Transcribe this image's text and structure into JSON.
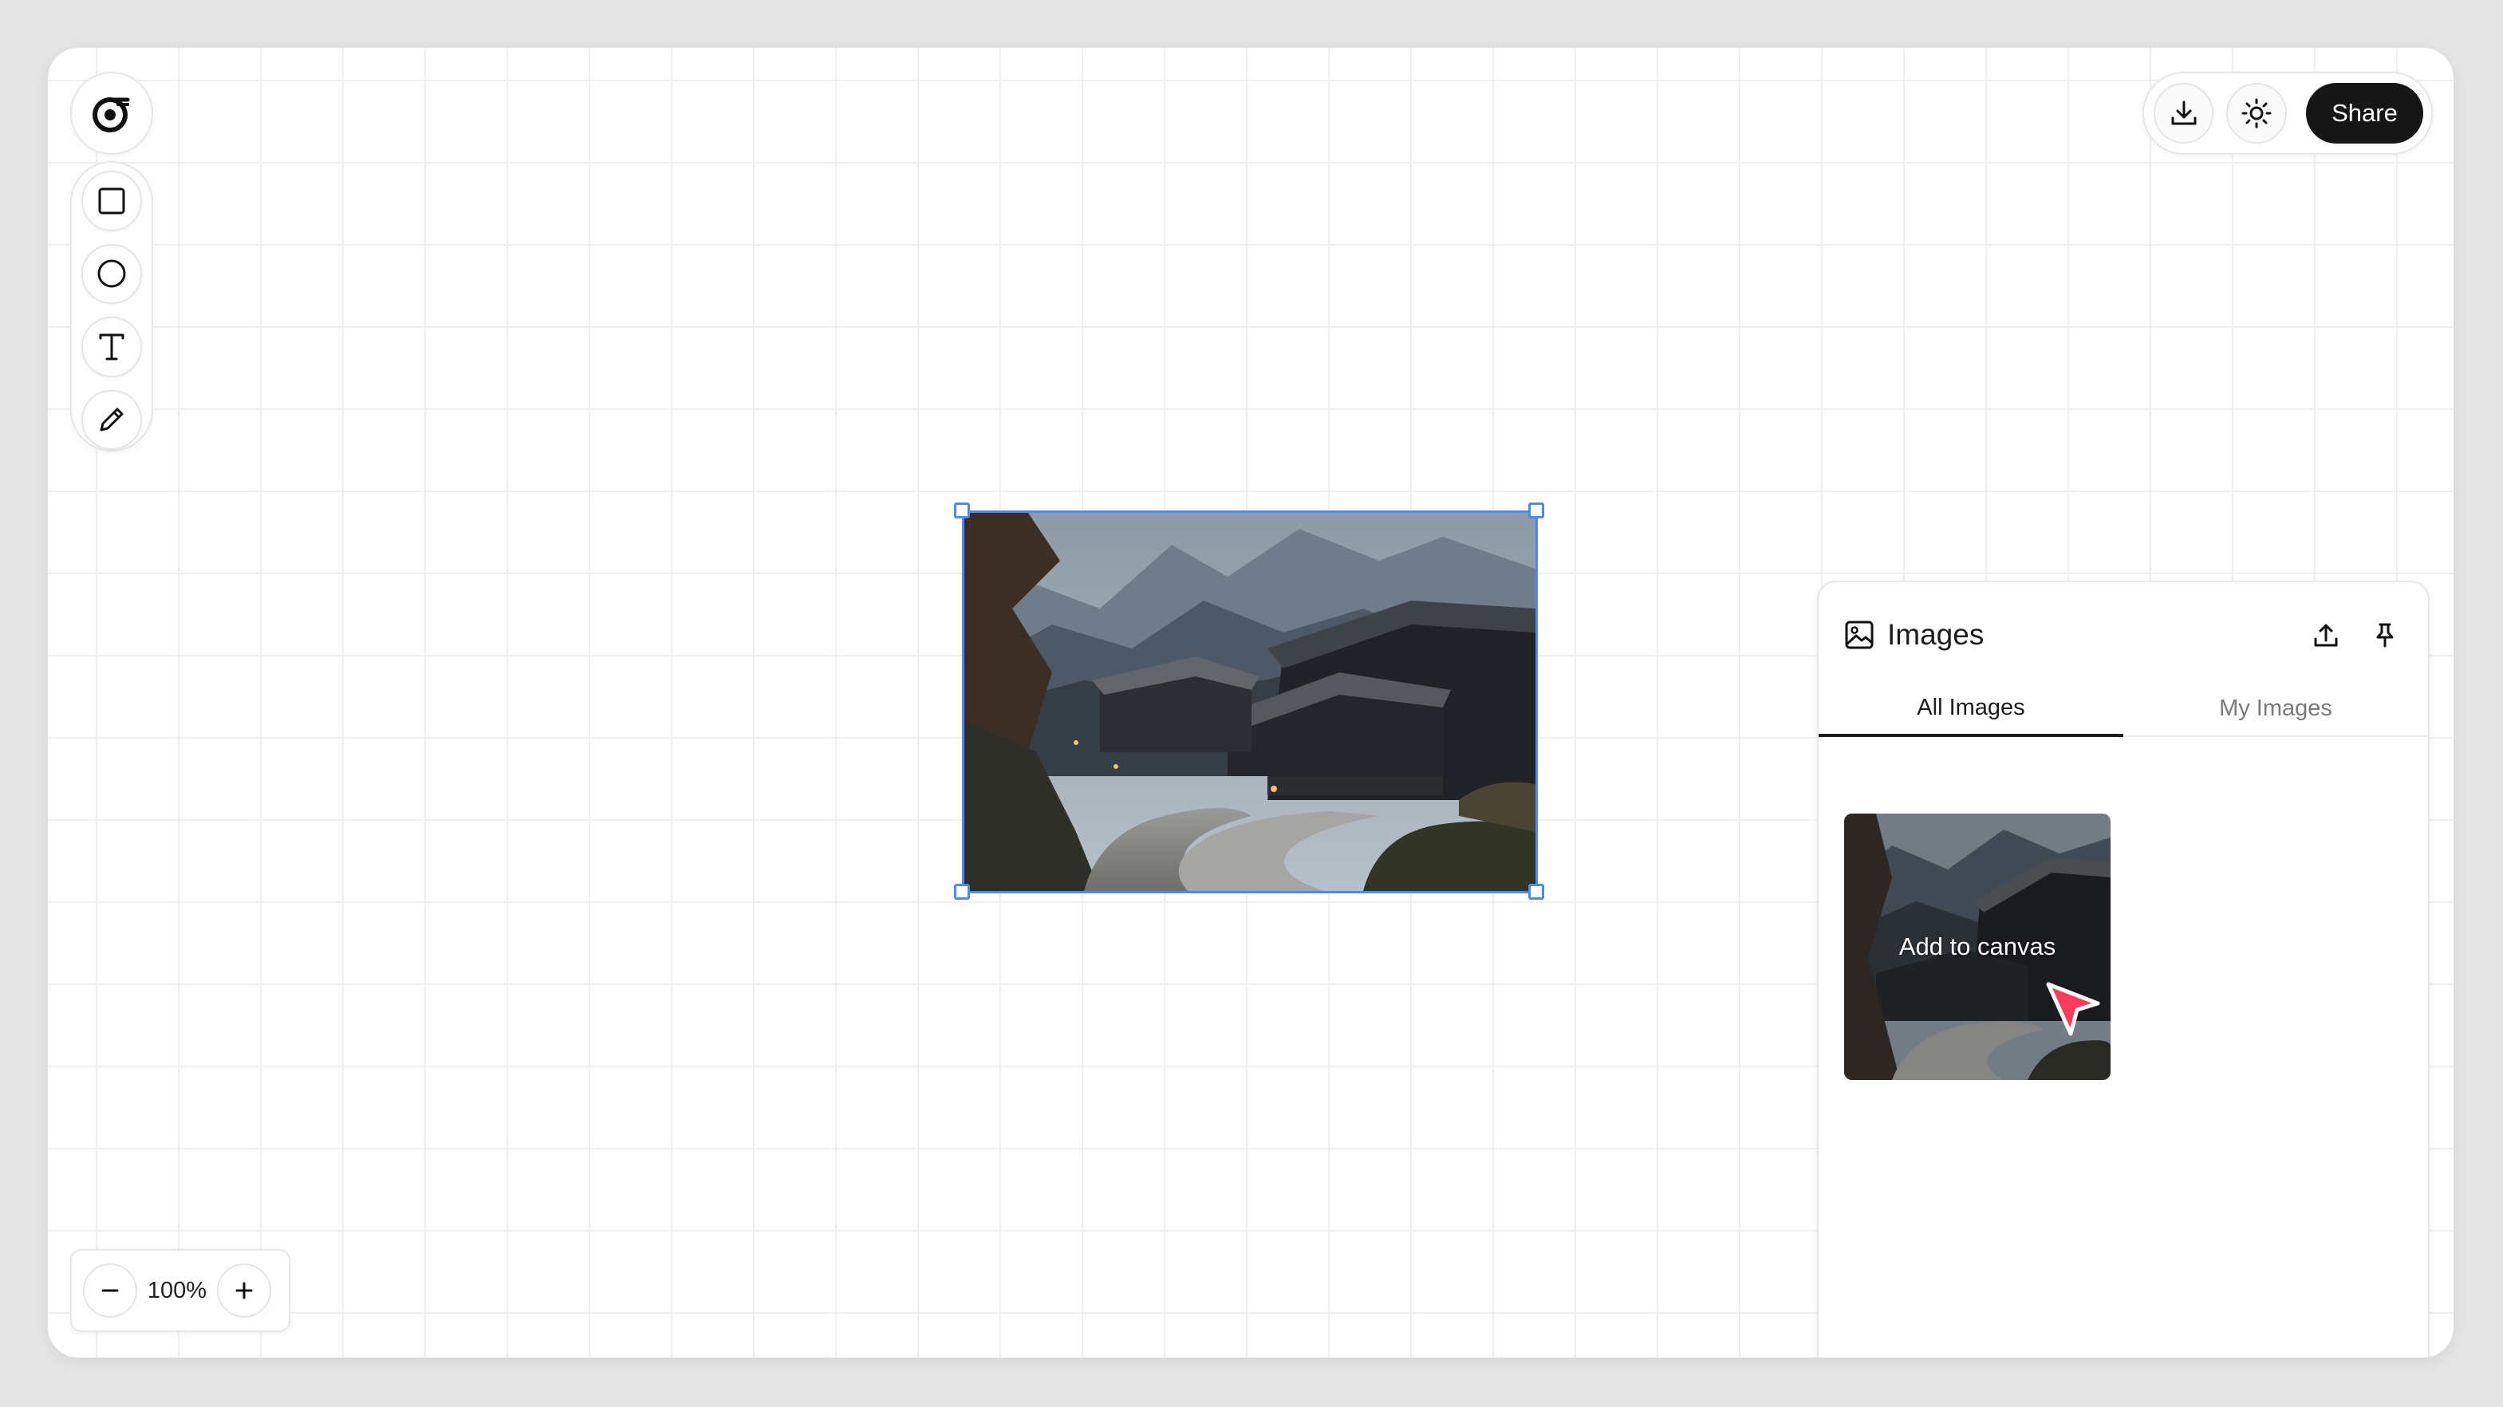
{
  "logo": {
    "name": "logo-icon"
  },
  "toolbar": {
    "tools": [
      {
        "id": "rectangle",
        "icon": "square-icon"
      },
      {
        "id": "ellipse",
        "icon": "circle-icon"
      },
      {
        "id": "text",
        "icon": "text-icon"
      },
      {
        "id": "pen",
        "icon": "pencil-icon"
      }
    ]
  },
  "actions": {
    "download_icon": "download-icon",
    "theme_icon": "sun-icon",
    "share_label": "Share"
  },
  "zoom": {
    "value": "100%",
    "decrease_icon": "minus-icon",
    "increase_icon": "plus-icon"
  },
  "images_panel": {
    "title": "Images",
    "tabs": [
      {
        "label": "All Images",
        "active": true
      },
      {
        "label": "My Images",
        "active": false
      }
    ],
    "thumbnail": {
      "hover_label": "Add to canvas"
    }
  },
  "colors": {
    "selection": "#4a8af4",
    "share_bg": "#161616",
    "cursor": "#ff3b5c"
  }
}
